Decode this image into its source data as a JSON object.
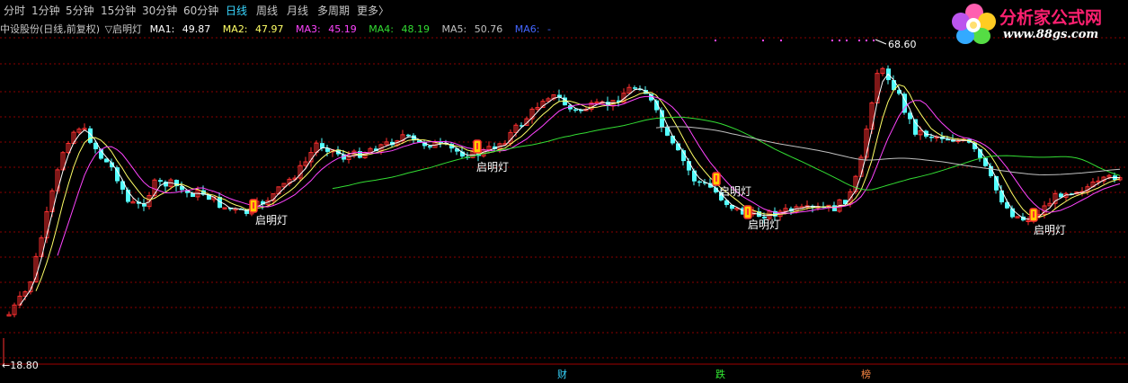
{
  "toolbar": {
    "items": [
      "分时",
      "1分钟",
      "5分钟",
      "15分钟",
      "30分钟",
      "60分钟",
      "日线",
      "周线",
      "月线",
      "多周期",
      "更多〉"
    ],
    "active": "日线"
  },
  "logo": {
    "title": "分析家公式网",
    "url": "www.88gs.com"
  },
  "legend": {
    "stock": "中设股份(日线,前复权)",
    "indicator": "▽启明灯",
    "ma": [
      {
        "label": "MA1:",
        "value": "49.87",
        "color": "#ffffff"
      },
      {
        "label": "MA2:",
        "value": "47.97",
        "color": "#ffff66"
      },
      {
        "label": "MA3:",
        "value": "45.19",
        "color": "#ff44ff"
      },
      {
        "label": "MA4:",
        "value": "48.19",
        "color": "#33dd33"
      },
      {
        "label": "MA5:",
        "value": "50.76",
        "color": "#c0c0c0"
      },
      {
        "label": "MA6:",
        "value": "-",
        "color": "#4466ff"
      }
    ]
  },
  "price_axis": {
    "high_label": "68.60",
    "low_label": "18.80"
  },
  "signals": {
    "label": "启明灯"
  },
  "events": [
    {
      "label": "财",
      "color": "#38d6ff"
    },
    {
      "label": "跌",
      "color": "#33ee33"
    },
    {
      "label": "榜",
      "color": "#ff8844"
    }
  ],
  "colors": {
    "background": "#000000",
    "up_candle": "#ff3030",
    "down_candle": "#54ffff",
    "grid": "#8a0000",
    "toolbar_active": "#38d6ff"
  }
}
